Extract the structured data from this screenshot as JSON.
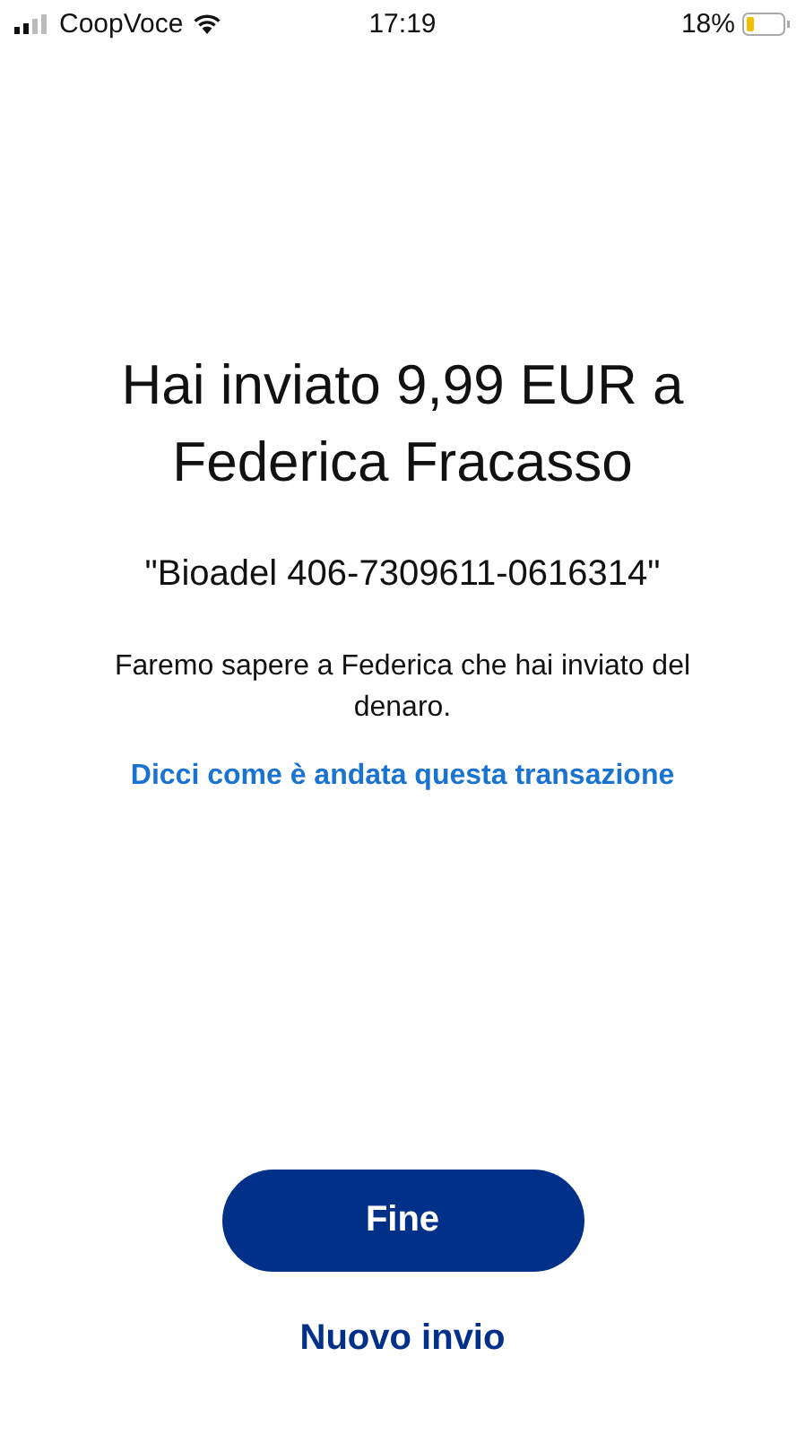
{
  "status_bar": {
    "carrier": "CoopVoce",
    "time": "17:19",
    "battery": "18%"
  },
  "title": "Hai inviato 9,99 EUR a Federica Fracasso",
  "note": "\"Bioadel 406-7309611-0616314\"",
  "message": "Faremo sapere a Federica che hai inviato del denaro.",
  "feedback_link": "Dicci come è andata questa transazione",
  "primary_button": "Fine",
  "secondary_button": "Nuovo invio"
}
